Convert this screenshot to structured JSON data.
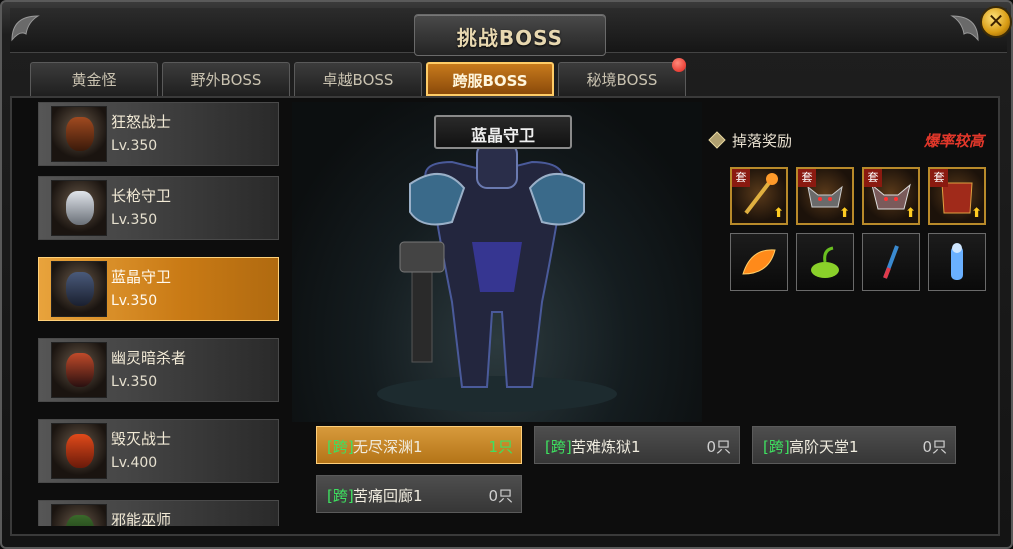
{
  "window": {
    "title": "挑战BOSS",
    "close_label": "✕"
  },
  "tabs": [
    {
      "label": "黄金怪",
      "active": false
    },
    {
      "label": "野外BOSS",
      "active": false
    },
    {
      "label": "卓越BOSS",
      "active": false
    },
    {
      "label": "跨服BOSS",
      "active": true
    },
    {
      "label": "秘境BOSS",
      "active": false,
      "has_notification": true
    }
  ],
  "boss_list": [
    {
      "name": "狂怒战士",
      "level": "Lv.350",
      "active": false
    },
    {
      "name": "长枪守卫",
      "level": "Lv.350",
      "active": false
    },
    {
      "name": "蓝晶守卫",
      "level": "Lv.350",
      "active": true
    },
    {
      "name": "幽灵暗杀者",
      "level": "Lv.350",
      "active": false
    },
    {
      "name": "毁灭战士",
      "level": "Lv.400",
      "active": false
    },
    {
      "name": "邪能巫师",
      "level": "",
      "active": false
    }
  ],
  "selected_boss": {
    "name": "蓝晶守卫"
  },
  "drops": {
    "title": "掉落奖励",
    "hint": "爆率较高",
    "set_badge": "套",
    "upgrade_arrow": "⬆",
    "items": [
      {
        "icon": "gold-staff-icon",
        "set": true
      },
      {
        "icon": "horned-helmet-icon",
        "set": true
      },
      {
        "icon": "horned-helmet-icon",
        "set": true
      },
      {
        "icon": "red-armor-icon",
        "set": true
      },
      {
        "icon": "orange-leaf-icon",
        "set": false
      },
      {
        "icon": "green-seed-icon",
        "set": false
      },
      {
        "icon": "feather-dart-icon",
        "set": false
      },
      {
        "icon": "blue-figure-icon",
        "set": false
      }
    ]
  },
  "maps": [
    {
      "tag": "[跨]",
      "name": "无尽深渊1",
      "count": "1只",
      "active": true
    },
    {
      "tag": "[跨]",
      "name": "苦难炼狱1",
      "count": "0只",
      "active": false
    },
    {
      "tag": "[跨]",
      "name": "高阶天堂1",
      "count": "0只",
      "active": false
    },
    {
      "tag": "[跨]",
      "name": "苦痛回廊1",
      "count": "0只",
      "active": false
    }
  ],
  "colors": {
    "accent_gold": "#d79a3c",
    "tag_green": "#3ee060",
    "hint_red": "#e2372a"
  }
}
